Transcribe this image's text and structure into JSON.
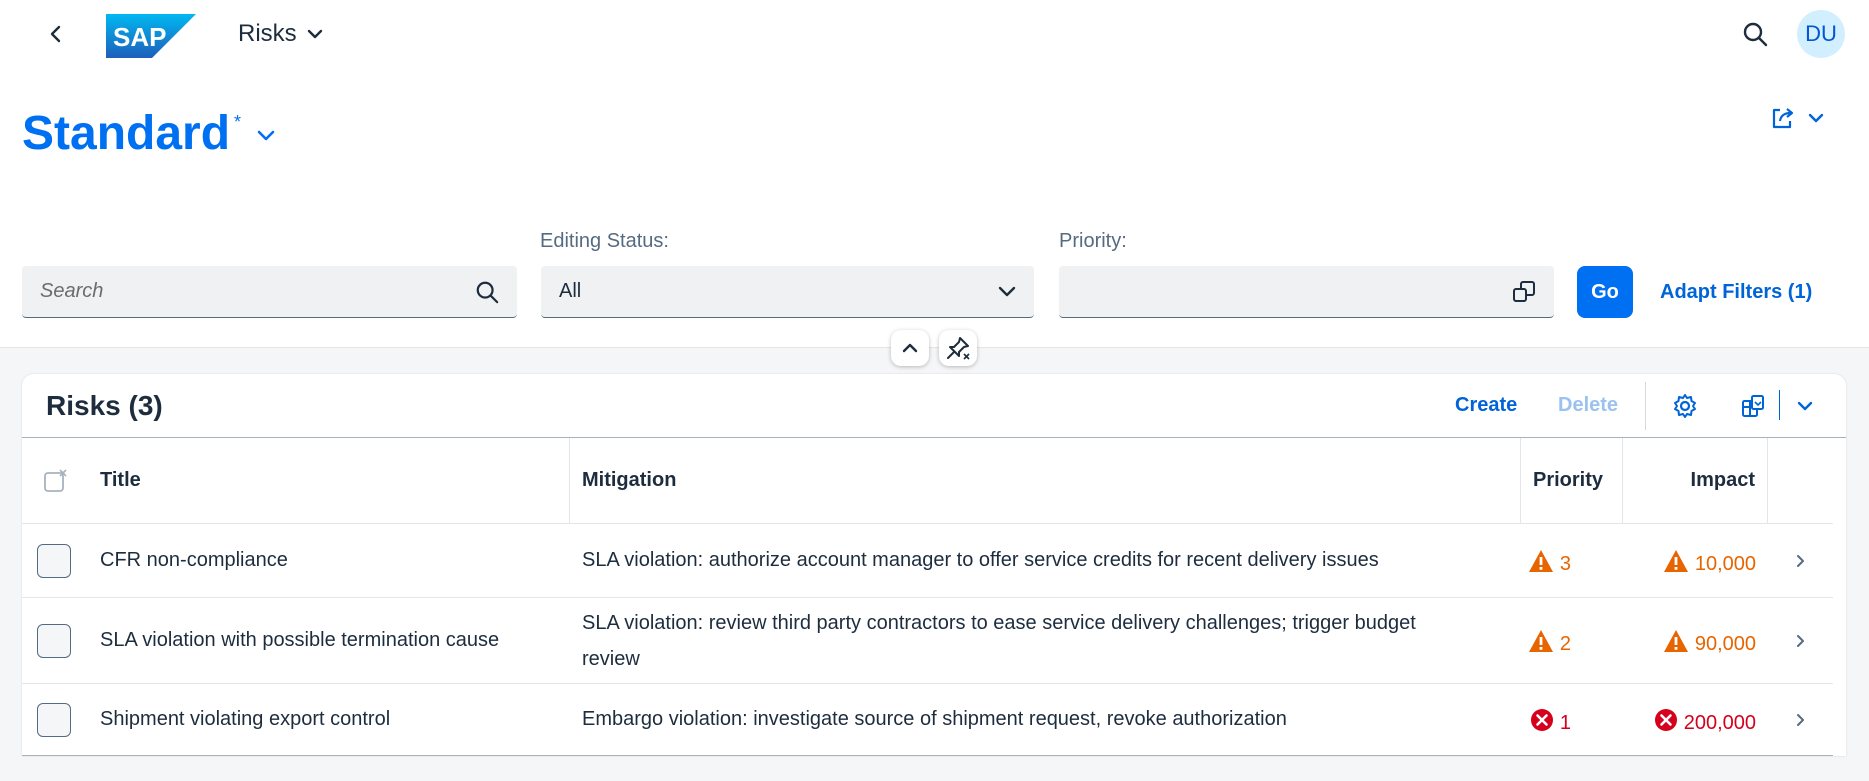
{
  "shell": {
    "logo_text": "SAP",
    "app_title": "Risks",
    "avatar_initials": "DU"
  },
  "variant": {
    "name": "Standard",
    "modified_marker": "*"
  },
  "filters": {
    "search_placeholder": "Search",
    "editing_status_label": "Editing Status:",
    "editing_status_value": "All",
    "priority_label": "Priority:",
    "priority_value": "",
    "go_label": "Go",
    "adapt_label": "Adapt Filters (1)"
  },
  "table": {
    "title": "Risks (3)",
    "create_label": "Create",
    "delete_label": "Delete",
    "columns": [
      "Title",
      "Mitigation",
      "Priority",
      "Impact"
    ],
    "rows": [
      {
        "title": "CFR non-compliance",
        "mitigation_lines": [
          "SLA violation: authorize account manager to offer service credits for recent delivery issues"
        ],
        "priority": "3",
        "impact": "10,000",
        "status": "warning"
      },
      {
        "title": "SLA violation with possible termination cause",
        "mitigation_lines": [
          "SLA violation: review third party contractors to ease service delivery challenges; trigger budget",
          "review"
        ],
        "priority": "2",
        "impact": "90,000",
        "status": "warning"
      },
      {
        "title": "Shipment violating export control",
        "mitigation_lines": [
          "Embargo violation: investigate source of shipment request, revoke authorization"
        ],
        "priority": "1",
        "impact": "200,000",
        "status": "error"
      }
    ]
  },
  "colors": {
    "brand": "#0070f2",
    "warning": "#e76500",
    "error": "#d6001c"
  }
}
